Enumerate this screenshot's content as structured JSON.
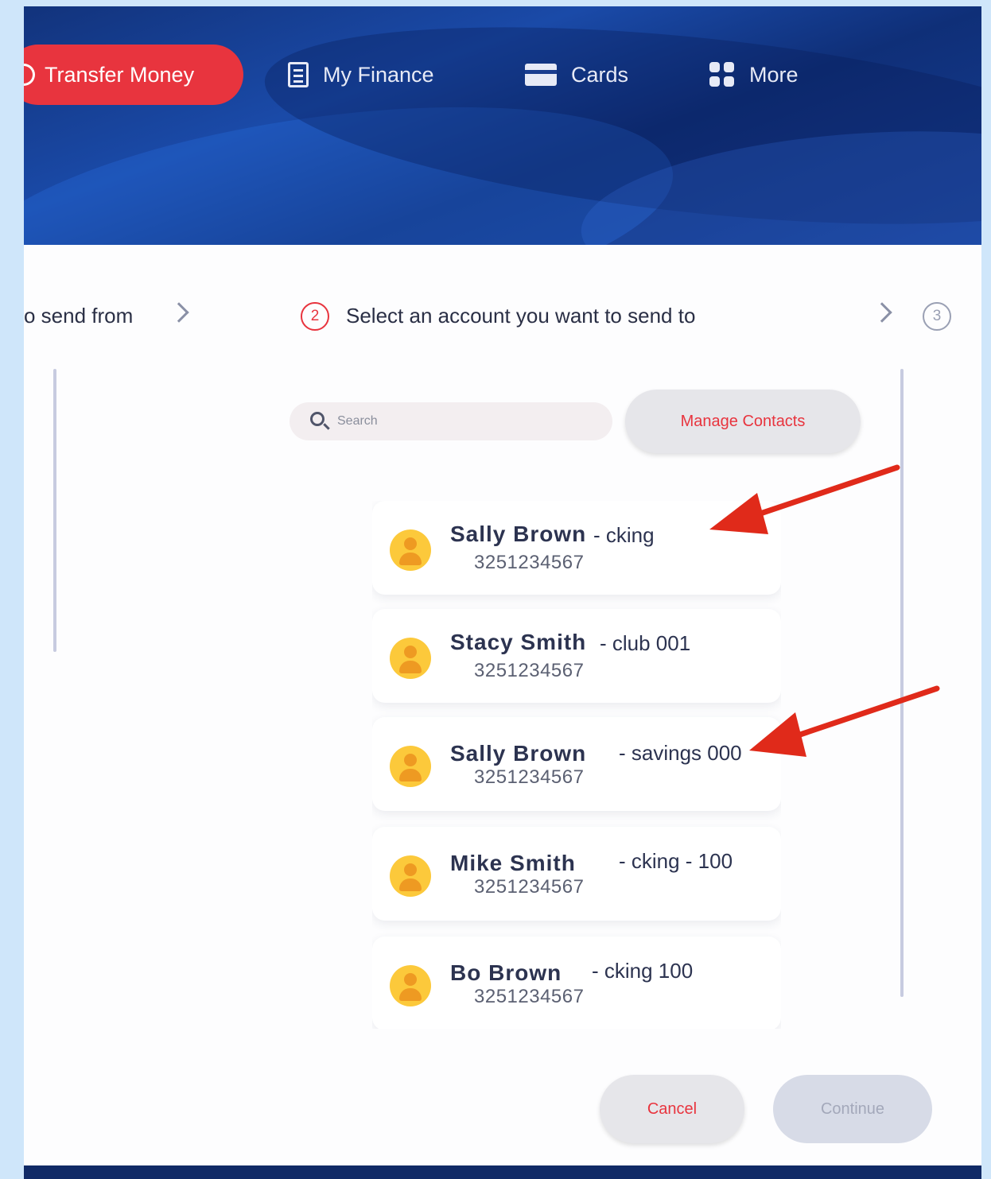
{
  "nav": {
    "transfer_label": "Transfer Money",
    "finance_label": "My Finance",
    "cards_label": "Cards",
    "more_label": "More"
  },
  "steps": {
    "step1_text": "o send from",
    "step2_number": "2",
    "step2_text": "Select an account you want to send to",
    "step3_number": "3"
  },
  "search": {
    "placeholder": "Search"
  },
  "manage_contacts_label": "Manage Contacts",
  "contacts": [
    {
      "name": "Sally Brown",
      "account": "- cking",
      "number": "3251234567"
    },
    {
      "name": "Stacy Smith",
      "account": "- club 001",
      "number": "3251234567"
    },
    {
      "name": "Sally Brown",
      "account": "- savings 000",
      "number": "3251234567"
    },
    {
      "name": "Mike Smith",
      "account": "- cking - 100",
      "number": "3251234567"
    },
    {
      "name": "Bo Brown",
      "account": "- cking 100",
      "number": "3251234567"
    }
  ],
  "buttons": {
    "cancel": "Cancel",
    "continue": "Continue"
  },
  "colors": {
    "accent": "#e8343e",
    "header": "#12337c",
    "arrow": "#e02a1a"
  },
  "annotations": {
    "arrow_targets": [
      "Sally Brown - cking",
      "Sally Brown - savings 000"
    ]
  }
}
